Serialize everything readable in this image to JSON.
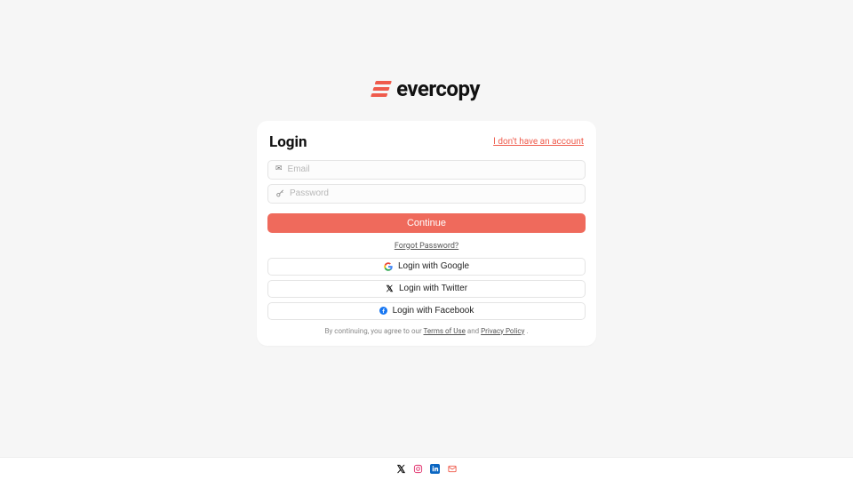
{
  "brand": {
    "name": "evercopy"
  },
  "card": {
    "title": "Login",
    "no_account_link": "I don't have an account",
    "email_placeholder": "Email",
    "password_placeholder": "Password",
    "continue_label": "Continue",
    "forgot_label": "Forgot Password?"
  },
  "social": {
    "google": "Login with Google",
    "twitter": "Login with Twitter",
    "facebook": "Login with Facebook"
  },
  "legal": {
    "prefix": "By continuing, you agree to our ",
    "terms": "Terms of Use",
    "sep": "  and ",
    "privacy": "Privacy Policy",
    "suffix": " ."
  }
}
